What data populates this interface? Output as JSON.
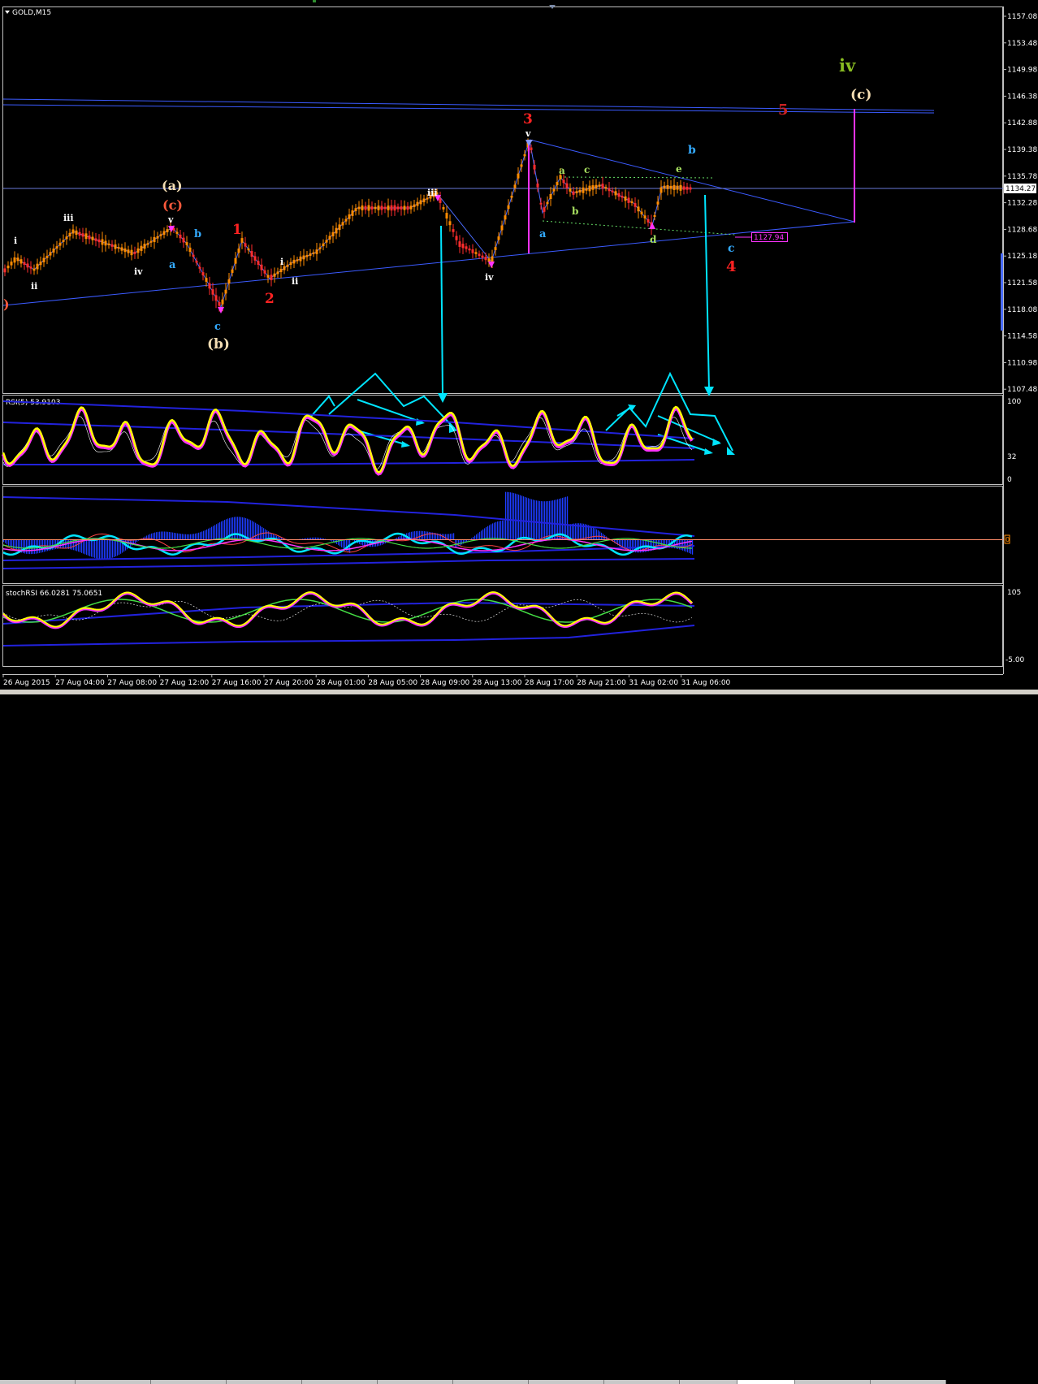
{
  "symbol_label": "GOLD,M15",
  "price_scale": [
    "1157.08",
    "1153.48",
    "1149.98",
    "1146.38",
    "1142.88",
    "1139.38",
    "1135.78",
    "1132.28",
    "1128.68",
    "1125.18",
    "1121.58",
    "1118.08",
    "1114.58",
    "1110.98",
    "1107.48"
  ],
  "current_price_tag": "1134.27",
  "level_tag": "1127.94",
  "time_axis": [
    "26 Aug 2015",
    "27 Aug 04:00",
    "27 Aug 08:00",
    "27 Aug 12:00",
    "27 Aug 16:00",
    "27 Aug 20:00",
    "28 Aug 01:00",
    "28 Aug 05:00",
    "28 Aug 09:00",
    "28 Aug 13:00",
    "28 Aug 17:00",
    "28 Aug 21:00",
    "31 Aug 02:00",
    "31 Aug 06:00"
  ],
  "rsi_label": "RSI(5) 53.9103",
  "rsi_levels": [
    "100",
    "32",
    "0"
  ],
  "macd_zero_tag": "0",
  "stochrsi_label": "stochRSI 66.0281 75.0651",
  "stochrsi_levels": [
    "105",
    "-5.00"
  ],
  "wave_labels": {
    "i1": "i",
    "ii1": "ii",
    "iii1": "iii",
    "iv1": "iv",
    "v1": "v",
    "a_bracket": "(a)",
    "c_bracket": "(c)",
    "b_bracket": "(b)",
    "a1": "a",
    "b1": "b",
    "c1": "c",
    "w1": "1",
    "w2": "2",
    "i2": "i",
    "ii2": "ii",
    "iii2": "iii",
    "iv2": "iv",
    "w3": "3",
    "v2": "v",
    "a2": "a",
    "a3": "a",
    "b2": "b",
    "c2": "c",
    "d1": "d",
    "e1": "e",
    "b3": "b",
    "c3": "c",
    "w4": "4",
    "w5": "5",
    "iv_big": "iv",
    "c_bracket2": "(c)",
    "pane1_0": "0"
  },
  "chart_data": {
    "type": "candlestick",
    "title": "GOLD,M15",
    "ylim": [
      1107.48,
      1157.08
    ],
    "last_price": 1134.27,
    "marked_level": 1127.94,
    "indicators": [
      "RSI(5) 53.9103",
      "stochRSI 66.0281 75.0651"
    ],
    "colors": {
      "bull": "#ff8c00",
      "bear": "#ff2d2d",
      "line": "#3b5bff",
      "cyan": "#00e5ff",
      "magenta": "#ff33ff",
      "yellow": "#ffff00"
    }
  }
}
